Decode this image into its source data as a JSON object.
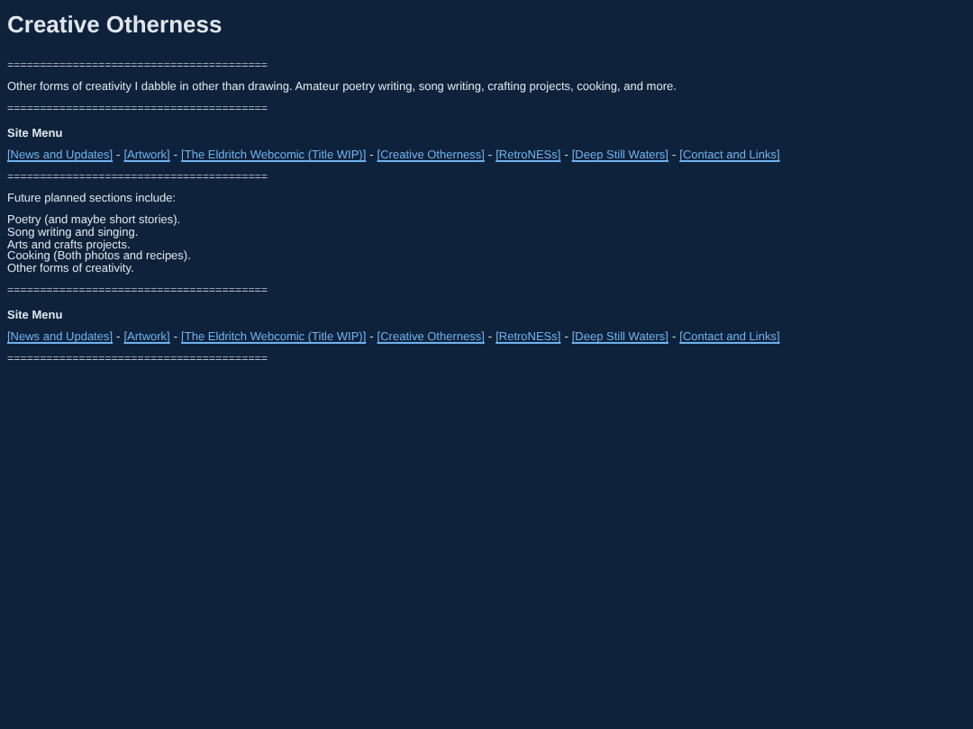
{
  "title": "Creative Otherness",
  "blocks": [
    {
      "kind": "divider",
      "text": "========================================"
    },
    {
      "kind": "paragraph",
      "text": "Other forms of creativity I dabble in other than drawing. Amateur poetry writing, song writing, crafting projects, cooking, and more."
    },
    {
      "kind": "divider",
      "text": "========================================"
    },
    {
      "kind": "menu",
      "heading": "Site Menu",
      "separator": "-",
      "links": [
        "[News and Updates]",
        "[Artwork]",
        "[The Eldritch Webcomic (Title WIP)]",
        "[Creative Otherness]",
        "[RetroNESs]",
        "[Deep Still Waters]",
        "[Contact and Links]"
      ]
    },
    {
      "kind": "divider",
      "text": "========================================"
    },
    {
      "kind": "paragraph",
      "text": "Future planned sections include:"
    },
    {
      "kind": "lines",
      "lines": [
        "Poetry (and maybe short stories).",
        "Song writing and singing.",
        "Arts and crafts projects.",
        "Cooking (Both photos and recipes).",
        "Other forms of creativity."
      ]
    },
    {
      "kind": "divider",
      "text": "========================================"
    },
    {
      "kind": "menu",
      "heading": "Site Menu",
      "separator": "-",
      "links": [
        "[News and Updates]",
        "[Artwork]",
        "[The Eldritch Webcomic (Title WIP)]",
        "[Creative Otherness]",
        "[RetroNESs]",
        "[Deep Still Waters]",
        "[Contact and Links]"
      ]
    },
    {
      "kind": "divider",
      "text": "========================================"
    }
  ]
}
